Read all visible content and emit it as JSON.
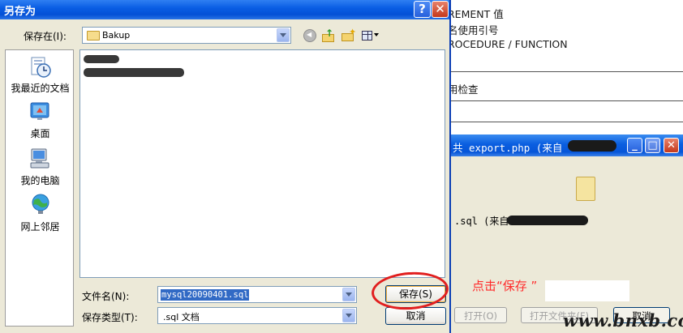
{
  "background_page": {
    "lines": [
      "REMENT 值",
      "名使用引号",
      "ROCEDURE / FUNCTION",
      "用检查"
    ]
  },
  "download_dialog": {
    "title": "共 export.php (来自",
    "file_text": ".sql (来自",
    "hint_text": "点击“保存 ”",
    "open_label": "打开(O)",
    "open_folder_label": "打开文件夹(F)",
    "cancel_label": "取消"
  },
  "save_dialog": {
    "title": "另存为",
    "help_button": "?",
    "close_button": "✕",
    "save_in_label": "保存在(I):",
    "save_in_value": "Bakup",
    "places": [
      {
        "label": "我最近的文档",
        "icon": "recent-documents-icon"
      },
      {
        "label": "桌面",
        "icon": "desktop-icon"
      },
      {
        "label": "我的电脑",
        "icon": "my-computer-icon"
      },
      {
        "label": "网上邻居",
        "icon": "network-places-icon"
      }
    ],
    "filename_label": "文件名(N):",
    "filename_value": "mysql20090401.sql",
    "filetype_label": "保存类型(T):",
    "filetype_value": ".sql 文档",
    "save_button": "保存(S)",
    "cancel_button": "取消"
  },
  "watermark": "www.bnxb.com",
  "colors": {
    "titlebar": "#0a5ee4",
    "annotation": "#e11f1f",
    "selection": "#316ac5"
  }
}
